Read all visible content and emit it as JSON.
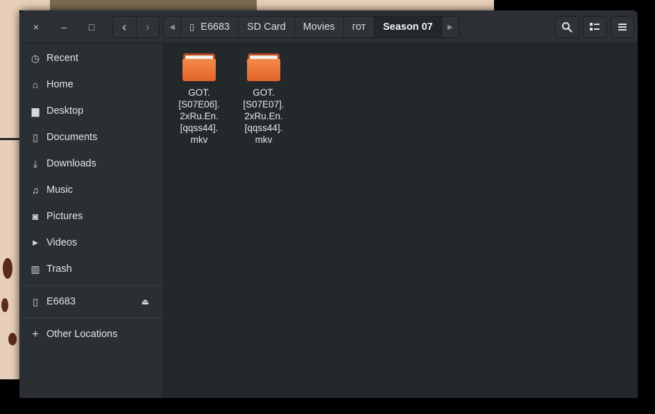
{
  "window": {
    "controls": {
      "close": "×",
      "minimize": "–",
      "maximize": "□"
    }
  },
  "nav": {
    "back_glyph": "‹",
    "forward_glyph": "›"
  },
  "pathbar": {
    "left_arrow": "◀",
    "right_arrow": "▶",
    "device_icon_glyph": "▯",
    "crumbs": [
      "E6683",
      "SD Card",
      "Movies",
      "гот",
      "Season 07"
    ],
    "current_index": 4
  },
  "header_buttons": {
    "search_icon": "search-icon",
    "view_icon": "list-view-icon",
    "menu_icon": "hamburger-menu-icon"
  },
  "sidebar": {
    "items": [
      {
        "label": "Recent",
        "icon": "recent-icon",
        "glyph": "◷"
      },
      {
        "label": "Home",
        "icon": "home-icon",
        "glyph": "⌂"
      },
      {
        "label": "Desktop",
        "icon": "desktop-folder-icon",
        "glyph": "▆"
      },
      {
        "label": "Documents",
        "icon": "document-icon",
        "glyph": "▯"
      },
      {
        "label": "Downloads",
        "icon": "download-icon",
        "glyph": "⤓"
      },
      {
        "label": "Music",
        "icon": "music-icon",
        "glyph": "♫"
      },
      {
        "label": "Pictures",
        "icon": "camera-icon",
        "glyph": "◙"
      },
      {
        "label": "Videos",
        "icon": "video-icon",
        "glyph": "▶"
      },
      {
        "label": "Trash",
        "icon": "trash-icon",
        "glyph": "▥"
      }
    ],
    "device": {
      "label": "E6683",
      "icon": "phone-icon",
      "glyph": "▯",
      "eject_glyph": "⏏"
    },
    "other": {
      "label": "Other Locations",
      "icon": "plus-icon",
      "glyph": "+"
    }
  },
  "files": [
    {
      "name_lines": [
        "GOT.",
        "[S07E06].",
        "2xRu.En.",
        "[qqss44].",
        "mkv"
      ],
      "type": "folder"
    },
    {
      "name_lines": [
        "GOT.",
        "[S07E07].",
        "2xRu.En.",
        "[qqss44].",
        "mkv"
      ],
      "type": "folder"
    }
  ],
  "colors": {
    "folder_orange": "#e8672b",
    "window_bg": "#2b2e32",
    "content_bg": "#25282b"
  }
}
